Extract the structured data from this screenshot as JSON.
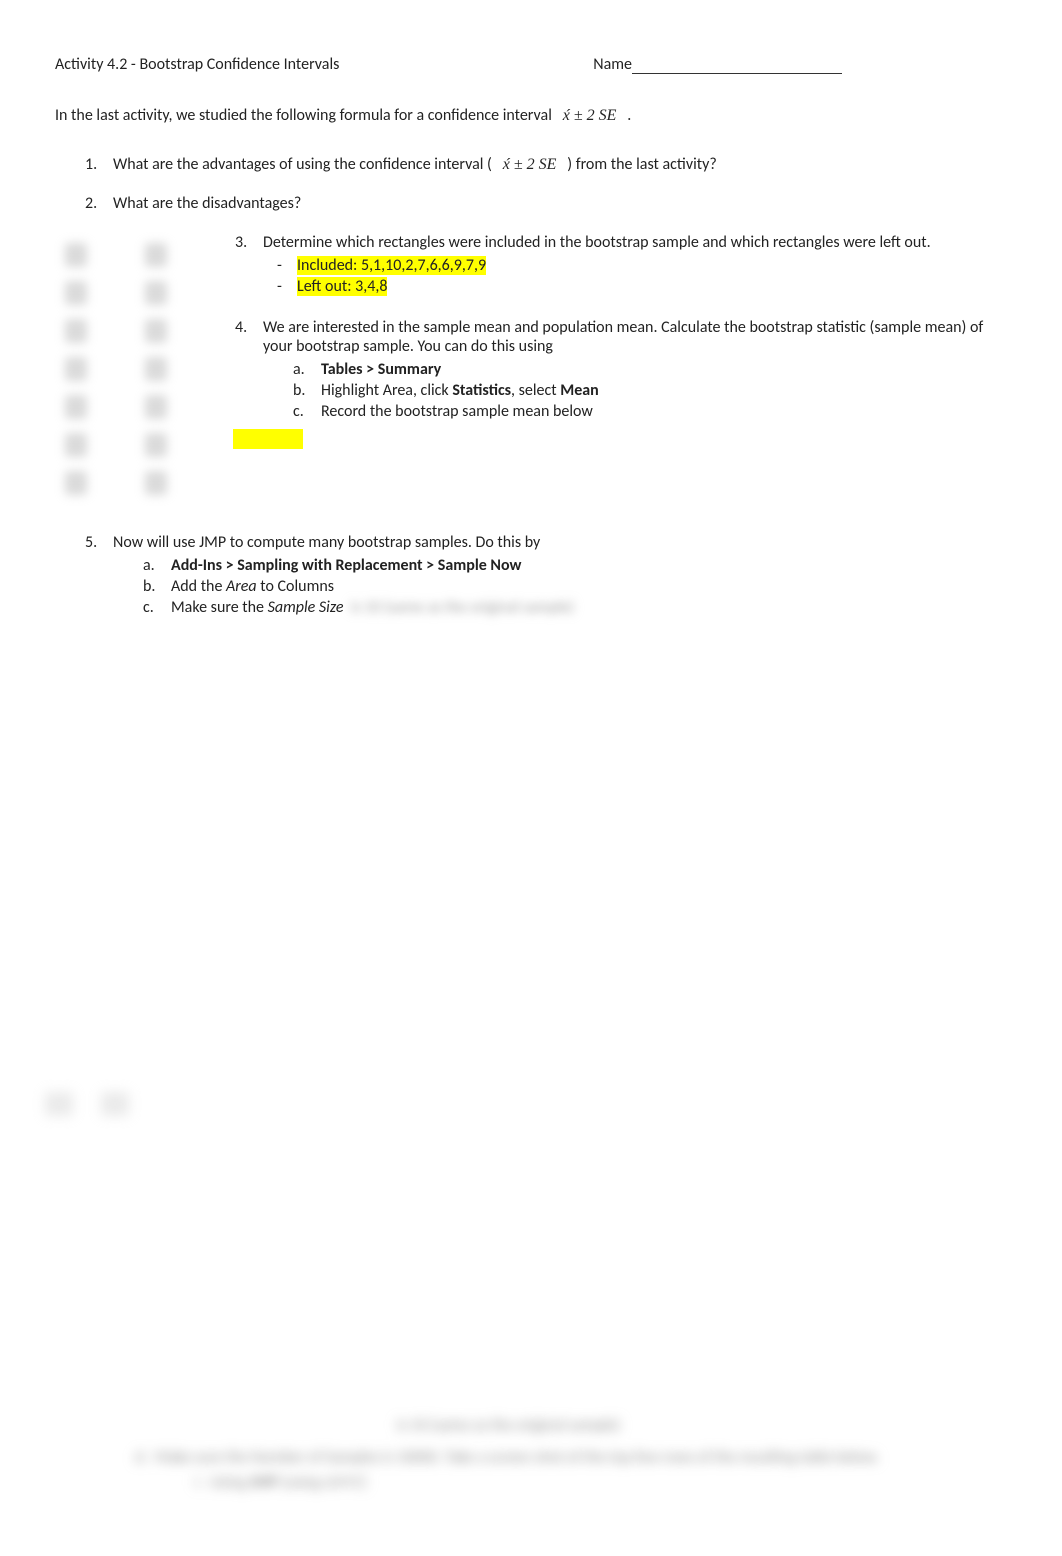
{
  "header": {
    "title": "Activity 4.2 - Bootstrap Confidence Intervals",
    "name_label": "Name"
  },
  "intro": {
    "text_before": "In the last activity, we studied the following formula for a confidence interval",
    "formula": "x́ ± 2 SE",
    "text_after": "."
  },
  "q1": {
    "num": "1.",
    "text_before": "What are the advantages of using the confidence interval (",
    "formula": "x́ ± 2 SE",
    "text_after": ") from the last activity?"
  },
  "q2": {
    "num": "2.",
    "text": "What are the disadvantages?"
  },
  "q3": {
    "num": "3.",
    "text": "Determine which rectangles were included in the bootstrap sample and which rectangles were left out.",
    "included_label": "Included: ",
    "included_val": "5,1,10,2,7,6,6,9,7,9",
    "leftout_label": "Left out: ",
    "leftout_val": "3,4,8"
  },
  "q4": {
    "num": "4.",
    "text": "We are interested in the sample mean and population mean.  Calculate the bootstrap statistic (sample mean) of your bootstrap sample.  You can do this using",
    "a": {
      "letter": "a.",
      "bold": "Tables > Summary"
    },
    "b": {
      "letter": "b.",
      "t1": "Highlight Area, click ",
      "bold1": "Statistics",
      "t2": ", select ",
      "bold2": "Mean"
    },
    "c": {
      "letter": "c.",
      "text": "Record the bootstrap sample mean below"
    }
  },
  "q5": {
    "num": "5.",
    "text": "Now will use JMP to compute many bootstrap samples.  Do this by",
    "a": {
      "letter": "a.",
      "bold": "Add-Ins > Sampling with Replacement > Sample Now"
    },
    "b": {
      "letter": "b.",
      "t1": "Add the ",
      "italic": "Area",
      "t2": " to Columns"
    },
    "c": {
      "letter": "c.",
      "t1": "Make sure the ",
      "italic": "Sample Size"
    }
  }
}
